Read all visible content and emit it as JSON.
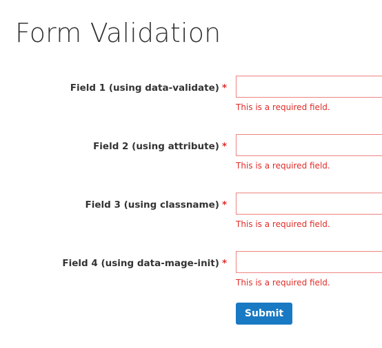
{
  "page": {
    "title": "Form Validation"
  },
  "form": {
    "required_marker": "*",
    "fields": [
      {
        "label": "Field 1 (using data-validate)",
        "value": "",
        "error": "This is a required field."
      },
      {
        "label": "Field 2 (using attribute)",
        "value": "",
        "error": "This is a required field."
      },
      {
        "label": "Field 3 (using classname)",
        "value": "",
        "error": "This is a required field."
      },
      {
        "label": "Field 4 (using data-mage-init)",
        "value": "",
        "error": "This is a required field."
      }
    ],
    "submit_label": "Submit"
  },
  "colors": {
    "error": "#e02b27",
    "input_error_border": "#ed8380",
    "button_bg": "#1979c3",
    "text": "#333333"
  }
}
